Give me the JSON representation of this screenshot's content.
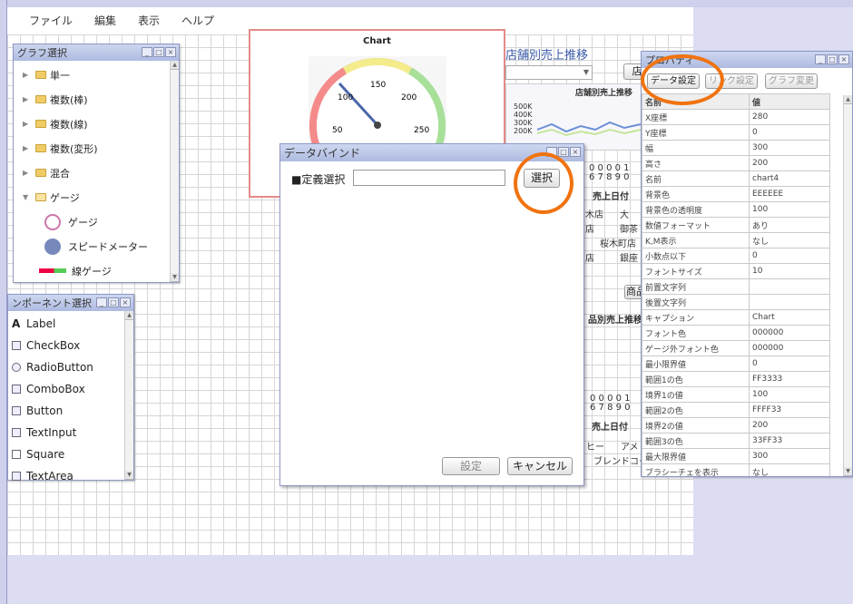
{
  "menu": [
    "ファイル",
    "編集",
    "表示",
    "ヘルプ"
  ],
  "graph_panel": {
    "title": "グラフ選択",
    "items": [
      {
        "label": "単一",
        "kind": "folder",
        "expanded": false
      },
      {
        "label": "複数(棒)",
        "kind": "folder",
        "expanded": false
      },
      {
        "label": "複数(線)",
        "kind": "folder",
        "expanded": false
      },
      {
        "label": "複数(変形)",
        "kind": "folder",
        "expanded": false
      },
      {
        "label": "混合",
        "kind": "folder",
        "expanded": false
      },
      {
        "label": "ゲージ",
        "kind": "folder",
        "expanded": true
      }
    ],
    "gauge_children": [
      "ゲージ",
      "スピードメーター",
      "線ゲージ"
    ]
  },
  "component_panel": {
    "title": "ンポーネント選択",
    "items": [
      "Label",
      "CheckBox",
      "RadioButton",
      "ComboBox",
      "Button",
      "TextInput",
      "Square",
      "TextArea"
    ]
  },
  "gauge_chart": {
    "title": "Chart",
    "ticks": [
      "50",
      "100",
      "150",
      "200",
      "250"
    ],
    "value": 80,
    "colors": {
      "range1": "#FF3333",
      "range2": "#FFFF33",
      "range3": "#33FF33"
    }
  },
  "background_fragments": {
    "store_title": "店舗別売上推移",
    "store_btn": "店",
    "chart_title": "店舗別売上推移",
    "y_labels": [
      "500K",
      "400K",
      "300K",
      "200K"
    ],
    "digits_top": "0 0 0 0 1",
    "digits_bot": "6 7 8 9 0",
    "axis_label": "売上日付",
    "legend": [
      "木店",
      "大",
      "店",
      "御茶",
      "桜木町店",
      "店",
      "銀座"
    ],
    "product_btn": "商品",
    "product_title": "品別売上推移",
    "digits2_top": "0 0 0 0 1",
    "digits2_bot": "6 7 8 9 0",
    "axis_label2": "売上日付",
    "legend2": [
      "ヒー",
      "アメ",
      "ブレンドコー"
    ]
  },
  "dialog": {
    "title": "データバインド",
    "label": "■定義選択",
    "input_value": "",
    "select_btn": "選択",
    "ok_btn": "設定",
    "cancel_btn": "キャンセル"
  },
  "property_panel": {
    "title": "プロパティ",
    "buttons": [
      "データ設定",
      "リンク設定",
      "グラフ変更"
    ],
    "header": [
      "名前",
      "値"
    ],
    "rows": [
      [
        "X座標",
        "280"
      ],
      [
        "Y座標",
        "0"
      ],
      [
        "幅",
        "300"
      ],
      [
        "高さ",
        "200"
      ],
      [
        "名前",
        "chart4"
      ],
      [
        "背景色",
        "EEEEEE"
      ],
      [
        "背景色の透明度",
        "100"
      ],
      [
        "数値フォーマット",
        "あり"
      ],
      [
        "K,M表示",
        "なし"
      ],
      [
        "小数点以下",
        "0"
      ],
      [
        "フォントサイズ",
        "10"
      ],
      [
        "前置文字列",
        ""
      ],
      [
        "後置文字列",
        ""
      ],
      [
        "キャプション",
        "Chart"
      ],
      [
        "フォント色",
        "000000"
      ],
      [
        "ゲージ外フォント色",
        "000000"
      ],
      [
        "最小限界値",
        "0"
      ],
      [
        "範囲1の色",
        "FF3333"
      ],
      [
        "境界1の値",
        "100"
      ],
      [
        "範囲2の色",
        "FFFF33"
      ],
      [
        "境界2の値",
        "200"
      ],
      [
        "範囲3の色",
        "33FF33"
      ],
      [
        "最大限界値",
        "300"
      ],
      [
        "ブラシーチェを表示",
        "なし"
      ]
    ]
  }
}
